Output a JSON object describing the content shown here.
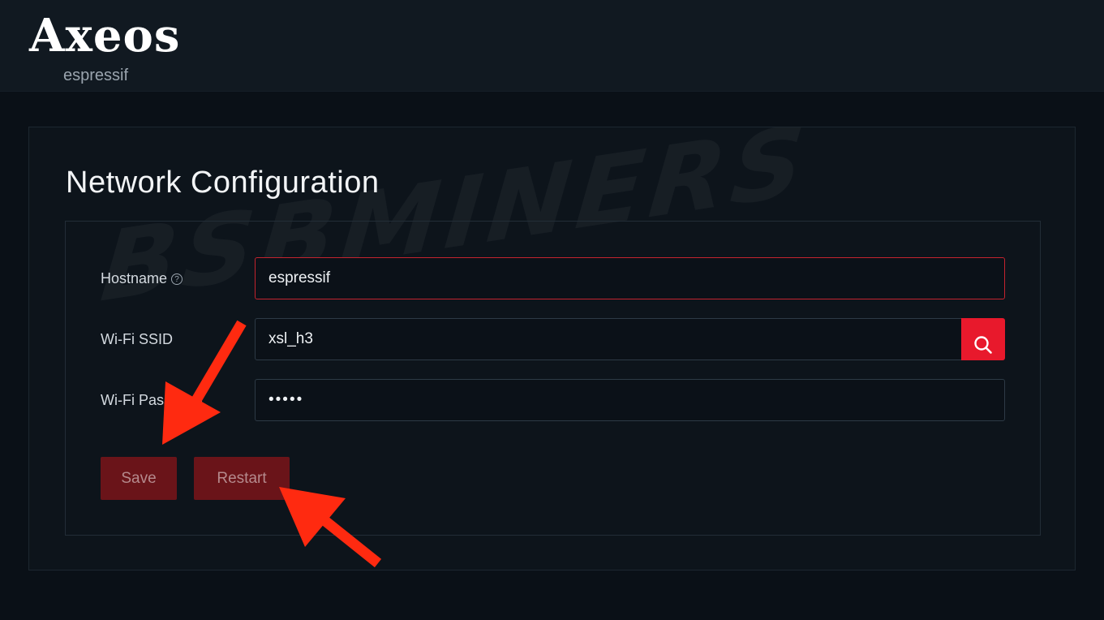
{
  "header": {
    "logo_text": "Axeos",
    "logo_subtitle": "espressif"
  },
  "watermark": "BSBMINERS",
  "page": {
    "title": "Network Configuration"
  },
  "form": {
    "hostname": {
      "label": "Hostname",
      "help_icon": "question-circle-icon",
      "value": "espressif"
    },
    "wifi_ssid": {
      "label": "Wi-Fi SSID",
      "value": "xsl_h3",
      "search_icon": "search-icon"
    },
    "wifi_password": {
      "label": "Wi-Fi Password",
      "value": "•••••"
    }
  },
  "actions": {
    "save_label": "Save",
    "restart_label": "Restart"
  },
  "colors": {
    "accent": "#e8192c",
    "button_bg": "#6a1419",
    "annotation_arrow": "#ff2a10",
    "background": "#0a1017"
  }
}
